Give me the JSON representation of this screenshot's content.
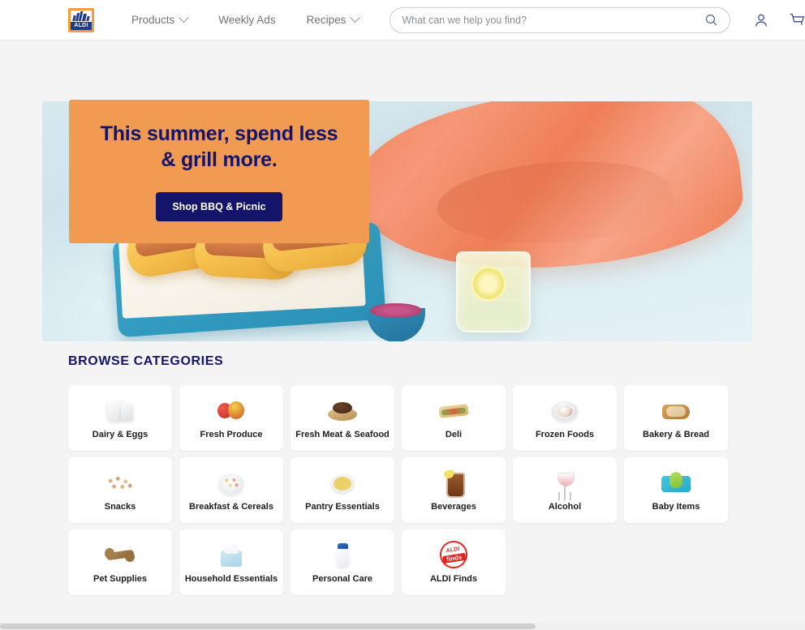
{
  "header": {
    "logo": {
      "name": "ALDI",
      "text": "ALDI"
    },
    "nav": [
      {
        "label": "Products",
        "has_dropdown": true
      },
      {
        "label": "Weekly Ads",
        "has_dropdown": false
      },
      {
        "label": "Recipes",
        "has_dropdown": true
      }
    ],
    "search": {
      "placeholder": "What can we help you find?",
      "value": "",
      "icon": "search-icon"
    },
    "account_icon": "account-icon",
    "cart_icon": "cart-icon"
  },
  "hero": {
    "title": "This summer, spend less & grill more.",
    "cta_label": "Shop BBQ & Picnic",
    "panel_color": "#f19a52",
    "cta_color": "#15146b",
    "image_alt": "Grilled halloumi salad, hot dogs on blue board and lemonade on light blue table with coral napkin"
  },
  "categories": {
    "title": "BROWSE CATEGORIES",
    "items": [
      {
        "label": "Dairy & Eggs",
        "icon": "milk-jug-icon"
      },
      {
        "label": "Fresh Produce",
        "icon": "apples-icon"
      },
      {
        "label": "Fresh Meat & Seafood",
        "icon": "steak-board-icon"
      },
      {
        "label": "Deli",
        "icon": "sandwich-icon"
      },
      {
        "label": "Frozen Foods",
        "icon": "ice-cream-bowl-icon"
      },
      {
        "label": "Bakery & Bread",
        "icon": "bread-board-icon"
      },
      {
        "label": "Snacks",
        "icon": "nuts-icon"
      },
      {
        "label": "Breakfast & Cereals",
        "icon": "cereal-bowl-icon"
      },
      {
        "label": "Pantry Essentials",
        "icon": "pasta-bowl-icon"
      },
      {
        "label": "Beverages",
        "icon": "iced-drink-icon"
      },
      {
        "label": "Alcohol",
        "icon": "wine-glass-icon"
      },
      {
        "label": "Baby Items",
        "icon": "baby-wipes-icon"
      },
      {
        "label": "Pet Supplies",
        "icon": "dog-bone-icon"
      },
      {
        "label": "Household Essentials",
        "icon": "tissue-box-icon"
      },
      {
        "label": "Personal Care",
        "icon": "shampoo-bottle-icon"
      },
      {
        "label": "ALDI Finds",
        "icon": "aldi-finds-stamp-icon"
      }
    ],
    "finds_stamp": {
      "line1": "ALDI",
      "line2": "finds",
      "color": "#e2241f"
    }
  },
  "page": {
    "background": "#f4f4f4"
  }
}
